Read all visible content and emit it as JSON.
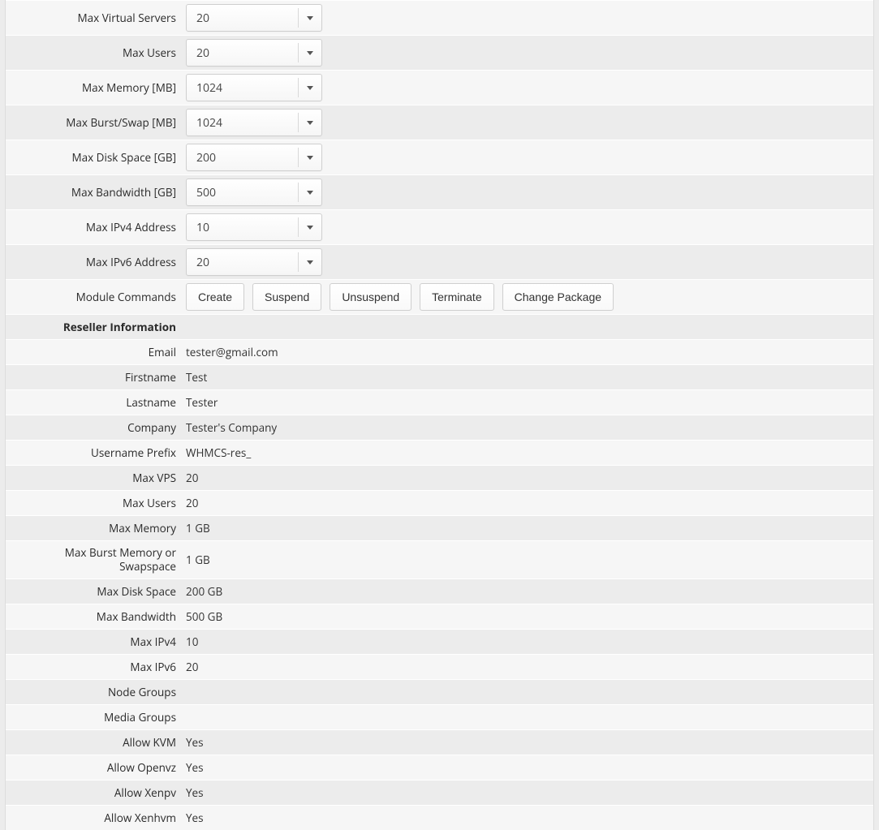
{
  "configRows": [
    {
      "label": "Max Virtual Servers",
      "value": "20"
    },
    {
      "label": "Max Users",
      "value": "20"
    },
    {
      "label": "Max Memory [MB]",
      "value": "1024"
    },
    {
      "label": "Max Burst/Swap [MB]",
      "value": "1024"
    },
    {
      "label": "Max Disk Space [GB]",
      "value": "200"
    },
    {
      "label": "Max Bandwidth [GB]",
      "value": "500"
    },
    {
      "label": "Max IPv4 Address",
      "value": "10"
    },
    {
      "label": "Max IPv6 Address",
      "value": "20"
    }
  ],
  "moduleCommands": {
    "label": "Module Commands",
    "buttons": [
      "Create",
      "Suspend",
      "Unsuspend",
      "Terminate",
      "Change Package"
    ]
  },
  "sectionHeader": "Reseller Information",
  "infoRows": [
    {
      "label": "Email",
      "value": "tester@gmail.com"
    },
    {
      "label": "Firstname",
      "value": "Test"
    },
    {
      "label": "Lastname",
      "value": "Tester"
    },
    {
      "label": "Company",
      "value": "Tester's Company"
    },
    {
      "label": "Username Prefix",
      "value": "WHMCS-res_"
    },
    {
      "label": "Max VPS",
      "value": "20"
    },
    {
      "label": "Max Users",
      "value": "20"
    },
    {
      "label": "Max Memory",
      "value": "1 GB"
    },
    {
      "label": "Max Burst Memory or Swapspace",
      "value": "1 GB",
      "multiline": true
    },
    {
      "label": "Max Disk Space",
      "value": "200 GB"
    },
    {
      "label": "Max Bandwidth",
      "value": "500 GB"
    },
    {
      "label": "Max IPv4",
      "value": "10"
    },
    {
      "label": "Max IPv6",
      "value": "20"
    },
    {
      "label": "Node Groups",
      "value": ""
    },
    {
      "label": "Media Groups",
      "value": ""
    },
    {
      "label": "Allow KVM",
      "value": "Yes"
    },
    {
      "label": "Allow Openvz",
      "value": "Yes"
    },
    {
      "label": "Allow Xenpv",
      "value": "Yes"
    },
    {
      "label": "Allow Xenhvm",
      "value": "Yes"
    }
  ]
}
